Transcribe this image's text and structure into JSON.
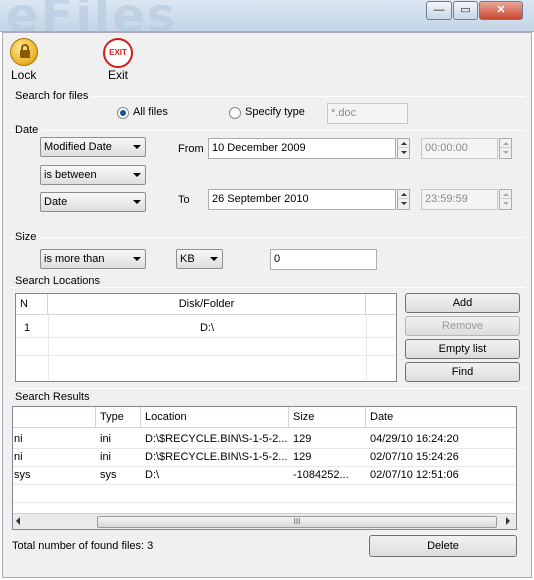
{
  "window": {
    "min_label": "—",
    "max_label": "▭",
    "close_label": "✕"
  },
  "toolbar": {
    "lock_label": "Lock",
    "exit_label": "Exit",
    "exit_icon_text": "EXIT"
  },
  "search_for_files": {
    "label": "Search for files",
    "all_files_label": "All files",
    "specify_type_label": "Specify type",
    "type_placeholder": "*.doc",
    "selected": "all_files"
  },
  "date": {
    "label": "Date",
    "field_select": "Modified Date",
    "condition_select": "is between",
    "mode_select": "Date",
    "from_label": "From",
    "from_date": "10  December  2009",
    "from_time": "00:00:00",
    "to_label": "To",
    "to_date": "26  September  2010",
    "to_time": "23:59:59"
  },
  "size": {
    "label": "Size",
    "condition_select": "is more than",
    "unit_select": "KB",
    "value": "0"
  },
  "search_locations": {
    "label": "Search Locations",
    "columns": [
      "N",
      "Disk/Folder"
    ],
    "rows": [
      {
        "n": "1",
        "folder": "D:\\"
      }
    ],
    "add_label": "Add",
    "remove_label": "Remove",
    "empty_label": "Empty list",
    "find_label": "Find"
  },
  "search_results": {
    "label": "Search Results",
    "columns": [
      "",
      "Type",
      "Location",
      "Size",
      "Date"
    ],
    "rows": [
      {
        "name": "ni",
        "type": "ini",
        "location": "D:\\$RECYCLE.BIN\\S-1-5-2...",
        "size": "129",
        "date": "04/29/10 16:24:20"
      },
      {
        "name": "ni",
        "type": "ini",
        "location": "D:\\$RECYCLE.BIN\\S-1-5-2...",
        "size": "129",
        "date": "02/07/10 15:24:26"
      },
      {
        "name": "sys",
        "type": "sys",
        "location": "D:\\",
        "size": "-1084252...",
        "date": "02/07/10 12:51:06"
      }
    ],
    "scroll_grip": "III"
  },
  "footer": {
    "total_label": "Total number of found files: 3",
    "delete_label": "Delete"
  }
}
